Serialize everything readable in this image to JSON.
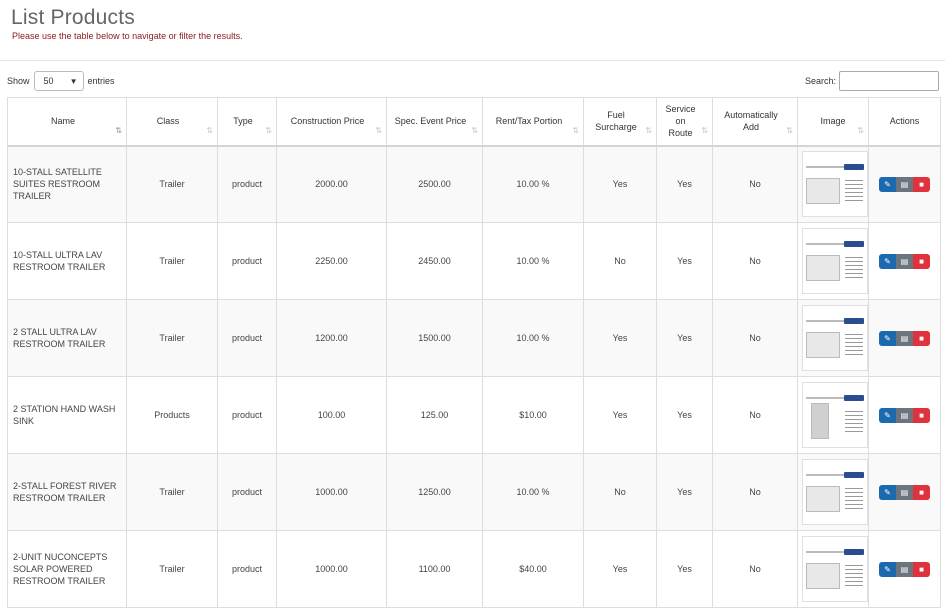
{
  "page": {
    "title": "List Products",
    "subtitle": "Please use the table below to navigate or filter the results."
  },
  "controls": {
    "show_label": "Show",
    "page_length": "50",
    "entries_label": "entries",
    "search_label": "Search:",
    "search_value": ""
  },
  "columns": [
    {
      "label": "Name"
    },
    {
      "label": "Class"
    },
    {
      "label": "Type"
    },
    {
      "label": "Construction Price"
    },
    {
      "label": "Spec. Event Price"
    },
    {
      "label": "Rent/Tax Portion"
    },
    {
      "label": "Fuel Surcharge"
    },
    {
      "label": "Service on Route"
    },
    {
      "label": "Automatically Add"
    },
    {
      "label": "Image"
    },
    {
      "label": "Actions"
    }
  ],
  "rows": [
    {
      "name": "10-STALL SATELLITE SUITES RESTROOM TRAILER",
      "class": "Trailer",
      "type": "product",
      "construction_price": "2000.00",
      "event_price": "2500.00",
      "rent_tax": "10.00 %",
      "fuel": "Yes",
      "service": "Yes",
      "auto_add": "No",
      "image": "trailer-flyer"
    },
    {
      "name": "10-STALL ULTRA LAV RESTROOM TRAILER",
      "class": "Trailer",
      "type": "product",
      "construction_price": "2250.00",
      "event_price": "2450.00",
      "rent_tax": "10.00 %",
      "fuel": "No",
      "service": "Yes",
      "auto_add": "No",
      "image": "trailer-flyer"
    },
    {
      "name": "2 STALL ULTRA LAV RESTROOM TRAILER",
      "class": "Trailer",
      "type": "product",
      "construction_price": "1200.00",
      "event_price": "1500.00",
      "rent_tax": "10.00 %",
      "fuel": "Yes",
      "service": "Yes",
      "auto_add": "No",
      "image": "trailer-flyer"
    },
    {
      "name": "2 STATION HAND WASH SINK",
      "class": "Products",
      "type": "product",
      "construction_price": "100.00",
      "event_price": "125.00",
      "rent_tax": "$10.00",
      "fuel": "Yes",
      "service": "Yes",
      "auto_add": "No",
      "image": "sink-flyer"
    },
    {
      "name": "2-STALL FOREST RIVER RESTROOM TRAILER",
      "class": "Trailer",
      "type": "product",
      "construction_price": "1000.00",
      "event_price": "1250.00",
      "rent_tax": "10.00 %",
      "fuel": "No",
      "service": "Yes",
      "auto_add": "No",
      "image": "trailer-flyer"
    },
    {
      "name": "2-UNIT NUCONCEPTS SOLAR POWERED RESTROOM TRAILER",
      "class": "Trailer",
      "type": "product",
      "construction_price": "1000.00",
      "event_price": "1100.00",
      "rent_tax": "$40.00",
      "fuel": "Yes",
      "service": "Yes",
      "auto_add": "No",
      "image": "trailer-flyer"
    }
  ],
  "colors": {
    "edit": "#1c6aae",
    "view": "#6c757d",
    "delete": "#e0323c",
    "subtitle": "#8b1a1a"
  },
  "icons": [
    "edit-icon",
    "document-icon",
    "trash-icon",
    "sort-icon",
    "chevron-down-icon"
  ]
}
